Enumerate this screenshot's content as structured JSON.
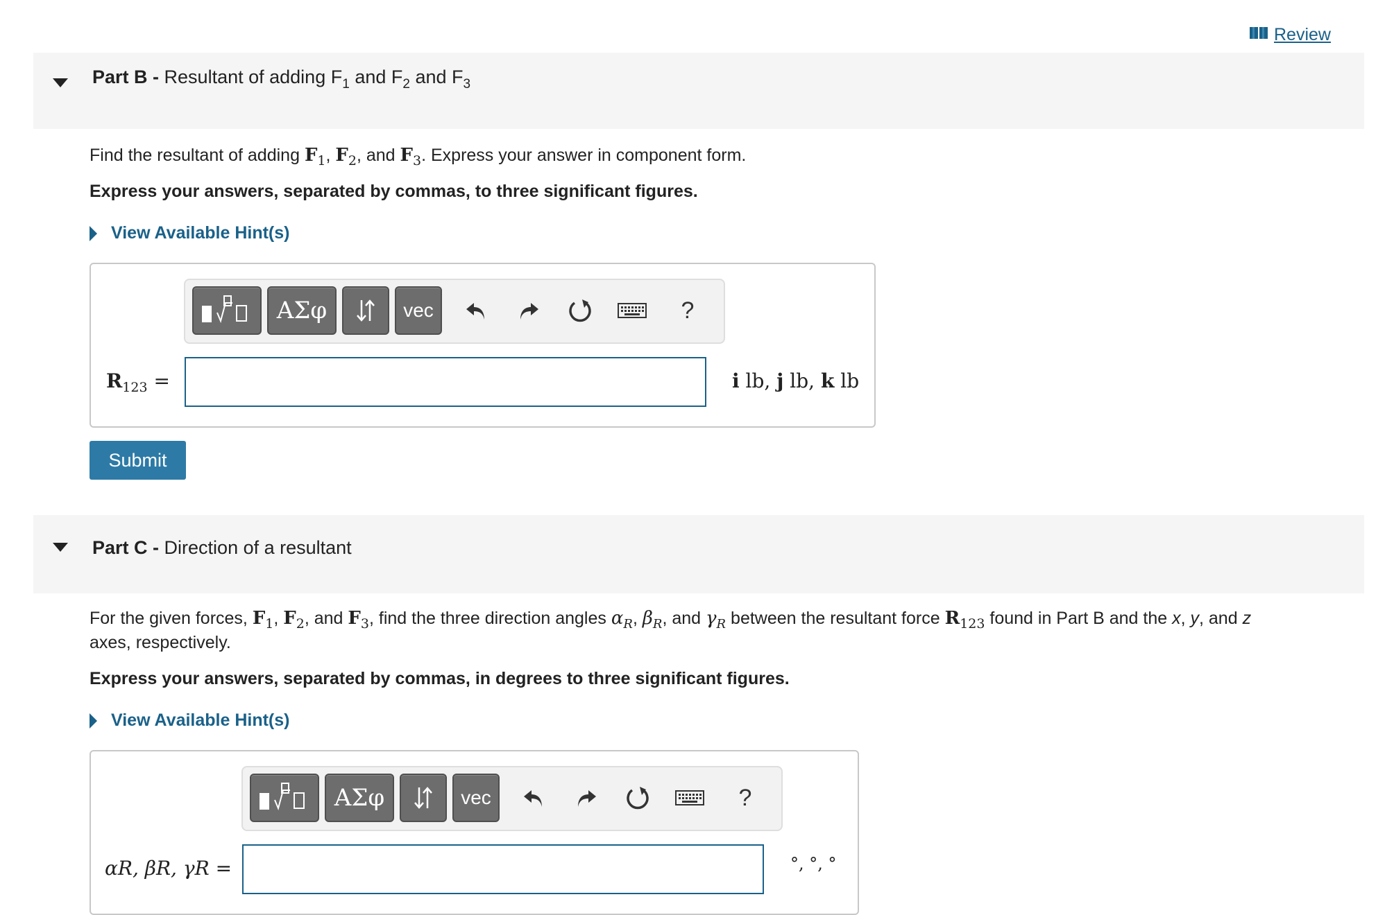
{
  "review": {
    "label": "Review"
  },
  "part_b": {
    "label": "Part B -",
    "title_pre": "Resultant of adding F",
    "title_and1": "and F",
    "title_and2": "and F",
    "sub1": "1",
    "sub2": "2",
    "sub3": "3",
    "prompt": {
      "pre": "Find the resultant of adding ",
      "F": "F",
      "s1": "1",
      "s2": "2",
      "s3": "3",
      "comma": ", ",
      "and": ", and ",
      "post": ". Express your answer in component form."
    },
    "instruction": "Express your answers, separated by commas, to three significant figures.",
    "hint": "View Available Hint(s)",
    "lhs_symbol": "R",
    "lhs_sub": "123",
    "equals": " =",
    "input_value": "",
    "units": {
      "i": "i",
      "j": "j",
      "k": "k",
      "lb": " lb, ",
      "lb_last": " lb"
    },
    "submit": "Submit"
  },
  "part_c": {
    "label": "Part C -",
    "title": "Direction of a resultant",
    "prompt": {
      "pre": "For the given forces, ",
      "F": "F",
      "s1": "1",
      "s2": "2",
      "s3": "3",
      "comma": ", ",
      "and": ", and ",
      "mid": ", find the three direction angles ",
      "alpha": "α",
      "beta": "β",
      "gamma": "γ",
      "R": "R",
      "and2": ", and ",
      "mid2": " between the resultant force ",
      "Rb": "R",
      "R123": "123",
      "post": " found in Part B and the ",
      "x": "x",
      "y": "y",
      "z": "z",
      "sep1": ", ",
      "sep2": ", and ",
      "line2": "axes, respectively."
    },
    "instruction": "Express your answers, separated by commas, in degrees to three significant figures.",
    "hint": "View Available Hint(s)",
    "lhs": "αR, βR, γR =",
    "input_value": "",
    "units": "°, °, °"
  },
  "toolbar": {
    "greek": "ΑΣφ",
    "vec": "vec",
    "help": "?",
    "icons": [
      "templates-icon",
      "greek-letters-icon",
      "arrows-icon",
      "vector-icon",
      "undo-icon",
      "redo-icon",
      "reset-icon",
      "keyboard-icon",
      "help-icon"
    ]
  },
  "colors": {
    "link": "#1a6189",
    "submit": "#2d7aa6",
    "header_bg": "#f5f5f5",
    "toolbar_btn": "#6d6d6d"
  }
}
